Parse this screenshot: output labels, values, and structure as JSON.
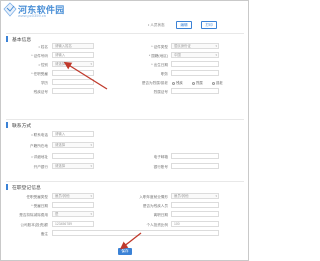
{
  "watermark": {
    "title": "河东软件园",
    "url": "www.pc0359.cn"
  },
  "toolbar": {
    "label": "• 人员状态",
    "edit_label": "编辑",
    "print_label": "打印"
  },
  "sections": {
    "basic": "基本信息",
    "contact": "联系方式",
    "enterprise": "在职登记信息"
  },
  "basic": {
    "name_label": "• 姓名",
    "name_value": "请输入姓名",
    "idtype_label": "* 证件类型",
    "idtype_value": "居民身份证",
    "idno_label": "* 证件号码",
    "idno_value": "请输入",
    "gender_label": "• 性别",
    "gender_value": "请选择",
    "nation_label": "* 国籍(地区)",
    "nation_value": "中国",
    "birth_label": "* 出生日期",
    "birth_value": "",
    "job_label": "* 任职受雇",
    "job_value": "",
    "position_label": "职务",
    "position_value": "",
    "education_label": "学历",
    "education_value": "",
    "disabled_label": "残疾人员",
    "disabled_value": "",
    "martyr_label": "是否为烈属/孤老",
    "martyr_options": [
      "残疾",
      "烈属",
      "孤老"
    ],
    "cert_label": "残疾证号",
    "cert_value": "",
    "cert2_label": "烈属证号",
    "cert2_value": ""
  },
  "contact": {
    "phone_label": "• 联系电话",
    "phone_value": "请输入",
    "addr_label": "户籍所在地",
    "addr_value": "请选择",
    "detail_label": "• 详细地址",
    "detail_value": "",
    "bank_label": "开户银行",
    "bank_value": "请选择",
    "email_label": "电子邮箱",
    "email_value": "",
    "account_label": "银行账号",
    "account_value": ""
  },
  "enterprise": {
    "type_label": "任职受雇类型",
    "type_value": "雇员/其他",
    "start_label": "入职年度就业情形",
    "start_value": "雇员/其他",
    "date_label": "* 受雇日期",
    "date_value": "",
    "tax_label": "是否扣除减除费用",
    "tax_value": "是",
    "leave_label": "离职日期",
    "leave_value": "",
    "person_label": "是否为残疾人员",
    "person_value": "",
    "salary_label": "公司股本(投资)额",
    "salary_value": "123456789",
    "ratio_label": "个人投资比例",
    "ratio_value": "100",
    "remark_label": "备注",
    "remark_value": ""
  },
  "save_label": "保存",
  "colors": {
    "accent": "#3b82d6",
    "arrow": "#c0392b"
  }
}
